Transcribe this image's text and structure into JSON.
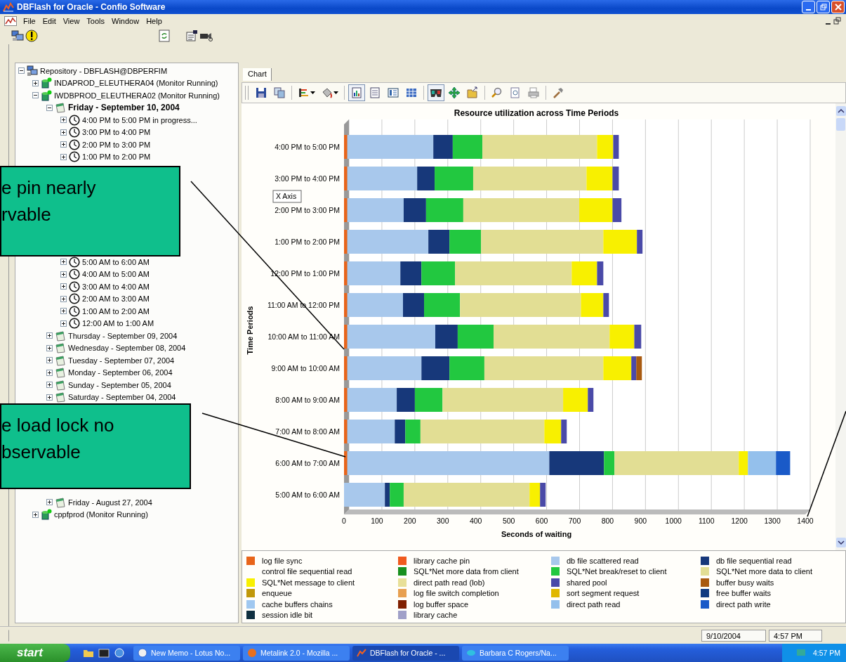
{
  "window": {
    "title": "DBFlash for Oracle - Confio Software"
  },
  "menu": [
    "File",
    "Edit",
    "View",
    "Tools",
    "Window",
    "Help"
  ],
  "toolbar": [
    {
      "kind": "computer"
    },
    {
      "kind": "alert"
    },
    {
      "kind": "refresh"
    },
    {
      "kind": "properties"
    },
    {
      "kind": "camera"
    }
  ],
  "tree": [
    {
      "label": "Repository - DBFLASH@DBPERFIM",
      "kind": "repository",
      "expanded": true,
      "selected": false,
      "children": [
        {
          "label": "INDAPROD_ELEUTHERA04 (Monitor Running)",
          "kind": "server",
          "expanded": false,
          "selected": false
        },
        {
          "label": "IWDBPROD_ELEUTHERA02 (Monitor Running)",
          "kind": "server",
          "expanded": true,
          "selected": false,
          "children": [
            {
              "label": "Friday - September 10, 2004",
              "kind": "day",
              "expanded": true,
              "selected": true,
              "children": [
                {
                  "label": "4:00 PM to 5:00 PM in progress...",
                  "kind": "period",
                  "expanded": false,
                  "selected": false
                },
                {
                  "label": "3:00 PM to 4:00 PM",
                  "kind": "period",
                  "expanded": false,
                  "selected": false
                },
                {
                  "label": "2:00 PM to 3:00 PM",
                  "kind": "period",
                  "expanded": false,
                  "selected": false
                },
                {
                  "label": "1:00 PM to 2:00 PM",
                  "kind": "period",
                  "expanded": false,
                  "selected": false
                },
                {
                  "label": "5:00 AM to 6:00 AM",
                  "kind": "period",
                  "expanded": false,
                  "selected": false
                },
                {
                  "label": "4:00 AM to 5:00 AM",
                  "kind": "period",
                  "expanded": false,
                  "selected": false
                },
                {
                  "label": "3:00 AM to 4:00 AM",
                  "kind": "period",
                  "expanded": false,
                  "selected": false
                },
                {
                  "label": "2:00 AM to 3:00 AM",
                  "kind": "period",
                  "expanded": false,
                  "selected": false
                },
                {
                  "label": "1:00 AM to 2:00 AM",
                  "kind": "period",
                  "expanded": false,
                  "selected": false
                },
                {
                  "label": "12:00 AM to 1:00 AM",
                  "kind": "period",
                  "expanded": false,
                  "selected": false
                }
              ]
            },
            {
              "label": "Thursday - September 09, 2004",
              "kind": "day",
              "expanded": false,
              "selected": false
            },
            {
              "label": "Wednesday - September 08, 2004",
              "kind": "day",
              "expanded": false,
              "selected": false
            },
            {
              "label": "Tuesday - September 07, 2004",
              "kind": "day",
              "expanded": false,
              "selected": false
            },
            {
              "label": "Monday - September 06, 2004",
              "kind": "day",
              "expanded": false,
              "selected": false
            },
            {
              "label": "Sunday - September 05, 2004",
              "kind": "day",
              "expanded": false,
              "selected": false
            },
            {
              "label": "Saturday - September 04, 2004",
              "kind": "day",
              "expanded": false,
              "selected": false
            },
            {
              "label": "Friday - August 27, 2004",
              "kind": "day",
              "expanded": false,
              "selected": false
            }
          ]
        },
        {
          "label": "cppfprod (Monitor Running)",
          "kind": "server",
          "expanded": false,
          "selected": false
        }
      ]
    }
  ],
  "tabs": [
    {
      "label": "Chart",
      "selected": true
    }
  ],
  "chart_toolbar": [
    [
      {
        "kind": "save",
        "pressed": false,
        "dropdown": false
      },
      {
        "kind": "copy",
        "pressed": false,
        "dropdown": false
      }
    ],
    [
      {
        "kind": "gallery",
        "pressed": false,
        "dropdown": true
      },
      {
        "kind": "paint",
        "pressed": false,
        "dropdown": true
      }
    ],
    [
      {
        "kind": "chart-view",
        "pressed": true,
        "dropdown": false
      },
      {
        "kind": "data-view",
        "pressed": false,
        "dropdown": false
      },
      {
        "kind": "legend",
        "pressed": false,
        "dropdown": false
      },
      {
        "kind": "grid",
        "pressed": false,
        "dropdown": false
      }
    ],
    [
      {
        "kind": "glasses",
        "pressed": true,
        "dropdown": false
      },
      {
        "kind": "move",
        "pressed": false,
        "dropdown": false
      },
      {
        "kind": "export",
        "pressed": false,
        "dropdown": false
      }
    ],
    [
      {
        "kind": "zoom",
        "pressed": false,
        "dropdown": false
      },
      {
        "kind": "preview",
        "pressed": false,
        "dropdown": false
      },
      {
        "kind": "print",
        "pressed": false,
        "dropdown": false
      }
    ],
    [
      {
        "kind": "tools",
        "pressed": false,
        "dropdown": false
      }
    ]
  ],
  "chart": {
    "tooltip": "X Axis",
    "chart_data": {
      "type": "bar",
      "orientation": "horizontal",
      "stacked": true,
      "title": "Resource utilization across Time Periods",
      "xlabel": "Seconds of waiting",
      "ylabel": "Time Periods",
      "categories": [
        "4:00 PM to 5:00 PM",
        "3:00 PM to 4:00 PM",
        "2:00 PM to 3:00 PM",
        "1:00 PM to 2:00 PM",
        "12:00 PM to 1:00 PM",
        "11:00 AM to 12:00 PM",
        "10:00 AM to 11:00 AM",
        "9:00 AM to 10:00 AM",
        "8:00 AM to 9:00 AM",
        "7:00 AM to 8:00 AM",
        "6:00 AM to 7:00 AM",
        "5:00 AM to 6:00 AM"
      ],
      "xlim": [
        0,
        1400
      ],
      "xticks": [
        0,
        100,
        200,
        300,
        400,
        500,
        600,
        700,
        800,
        900,
        1000,
        1100,
        1200,
        1300,
        1400
      ],
      "series": [
        {
          "name": "log file sync",
          "color": "#e8641a",
          "values": [
            10,
            10,
            10,
            10,
            10,
            10,
            10,
            10,
            10,
            10,
            10,
            null
          ]
        },
        {
          "name": "library cache pin",
          "color": "#f05a1e",
          "values": [
            null,
            null,
            null,
            null,
            null,
            null,
            null,
            null,
            null,
            null,
            null,
            null
          ]
        },
        {
          "name": "db file scattered read",
          "color": "#a8c8ec",
          "values": [
            261,
            212,
            171,
            246,
            161,
            169,
            267,
            225,
            150,
            144,
            613,
            124
          ]
        },
        {
          "name": "db file sequential read",
          "color": "#17387a",
          "values": [
            59,
            53,
            68,
            64,
            64,
            64,
            68,
            85,
            55,
            32,
            166,
            15
          ]
        },
        {
          "name": "control file sequential read",
          "values": [
            null,
            null,
            null,
            null,
            null,
            null,
            null,
            null,
            null,
            null,
            null,
            null
          ]
        },
        {
          "name": "SQL*Net more data from client",
          "color": "#18901e",
          "values": [
            null,
            null,
            null,
            null,
            null,
            null,
            null,
            null,
            null,
            null,
            null,
            null
          ]
        },
        {
          "name": "SQL*Net break/reset to client",
          "color": "#22c840",
          "values": [
            90,
            117,
            113,
            96,
            102,
            109,
            109,
            106,
            84,
            46,
            32,
            42
          ]
        },
        {
          "name": "SQL*Net more data to client",
          "color": "#e2de94",
          "values": [
            348,
            344,
            352,
            371,
            354,
            367,
            352,
            361,
            366,
            376,
            377,
            382
          ]
        },
        {
          "name": "SQL*Net message to client",
          "color": "#f8f000",
          "values": [
            49,
            79,
            101,
            102,
            77,
            68,
            75,
            85,
            75,
            51,
            28,
            32
          ]
        },
        {
          "name": "direct path read (lob)",
          "color": "#e8e098",
          "values": [
            null,
            null,
            null,
            null,
            null,
            null,
            null,
            null,
            null,
            null,
            null,
            null
          ]
        },
        {
          "name": "shared pool",
          "color": "#4a4aa8",
          "values": [
            17,
            19,
            27,
            17,
            19,
            17,
            21,
            15,
            17,
            17,
            null,
            17
          ]
        },
        {
          "name": "buffer busy waits",
          "color": "#a85a10",
          "values": [
            null,
            null,
            null,
            null,
            null,
            null,
            null,
            17,
            null,
            null,
            null,
            null
          ]
        },
        {
          "name": "enqueue",
          "color": "#c0980a",
          "values": [
            null,
            null,
            null,
            null,
            null,
            null,
            null,
            null,
            null,
            null,
            null,
            null
          ]
        },
        {
          "name": "log file switch completion",
          "color": "#e8a050",
          "values": [
            null,
            null,
            null,
            null,
            null,
            null,
            null,
            null,
            null,
            null,
            null,
            null
          ]
        },
        {
          "name": "sort segment request",
          "color": "#e0b800",
          "values": [
            null,
            null,
            null,
            null,
            null,
            null,
            null,
            null,
            null,
            null,
            null,
            null
          ]
        },
        {
          "name": "free buffer waits",
          "color": "#103a80",
          "values": [
            null,
            null,
            null,
            null,
            null,
            null,
            null,
            null,
            null,
            null,
            null,
            null
          ]
        },
        {
          "name": "cache buffers chains",
          "color": "#a0c8f0",
          "values": [
            null,
            null,
            null,
            null,
            null,
            null,
            null,
            null,
            null,
            null,
            null,
            null
          ]
        },
        {
          "name": "log buffer space",
          "color": "#802000",
          "values": [
            null,
            null,
            null,
            null,
            null,
            null,
            null,
            null,
            null,
            null,
            null,
            null
          ]
        },
        {
          "name": "direct path read",
          "color": "#94c0ec",
          "values": [
            null,
            null,
            null,
            null,
            null,
            null,
            null,
            null,
            null,
            null,
            85,
            null
          ]
        },
        {
          "name": "direct path write",
          "color": "#1a5ac8",
          "values": [
            null,
            null,
            null,
            null,
            null,
            null,
            null,
            null,
            null,
            null,
            43,
            null
          ]
        },
        {
          "name": "session idle bit",
          "color": "#103040",
          "values": [
            null,
            null,
            null,
            null,
            null,
            null,
            null,
            null,
            null,
            null,
            null,
            null
          ]
        },
        {
          "name": "library cache",
          "color": "#a0a0c8",
          "values": [
            null,
            null,
            null,
            null,
            null,
            null,
            null,
            null,
            null,
            null,
            null,
            null
          ]
        }
      ]
    }
  },
  "status_bar": [
    "9/10/2004",
    "4:57 PM"
  ],
  "taskbar": {
    "start": "start",
    "tasks": [
      {
        "label": "New Memo - Lotus No...",
        "kind": "memo",
        "selected": false
      },
      {
        "label": "Metalink 2.0 - Mozilla ...",
        "kind": "browser",
        "selected": false
      },
      {
        "label": "DBFlash for Oracle - ...",
        "kind": "app",
        "selected": true
      },
      {
        "label": "Barbara C Rogers/Na...",
        "kind": "chat",
        "selected": false
      }
    ],
    "clock": "4:57 PM"
  },
  "callouts": [
    {
      "lines": [
        "e pin nearly",
        "rvable"
      ]
    },
    {
      "lines": [
        "e load lock no",
        "bservable"
      ]
    }
  ]
}
